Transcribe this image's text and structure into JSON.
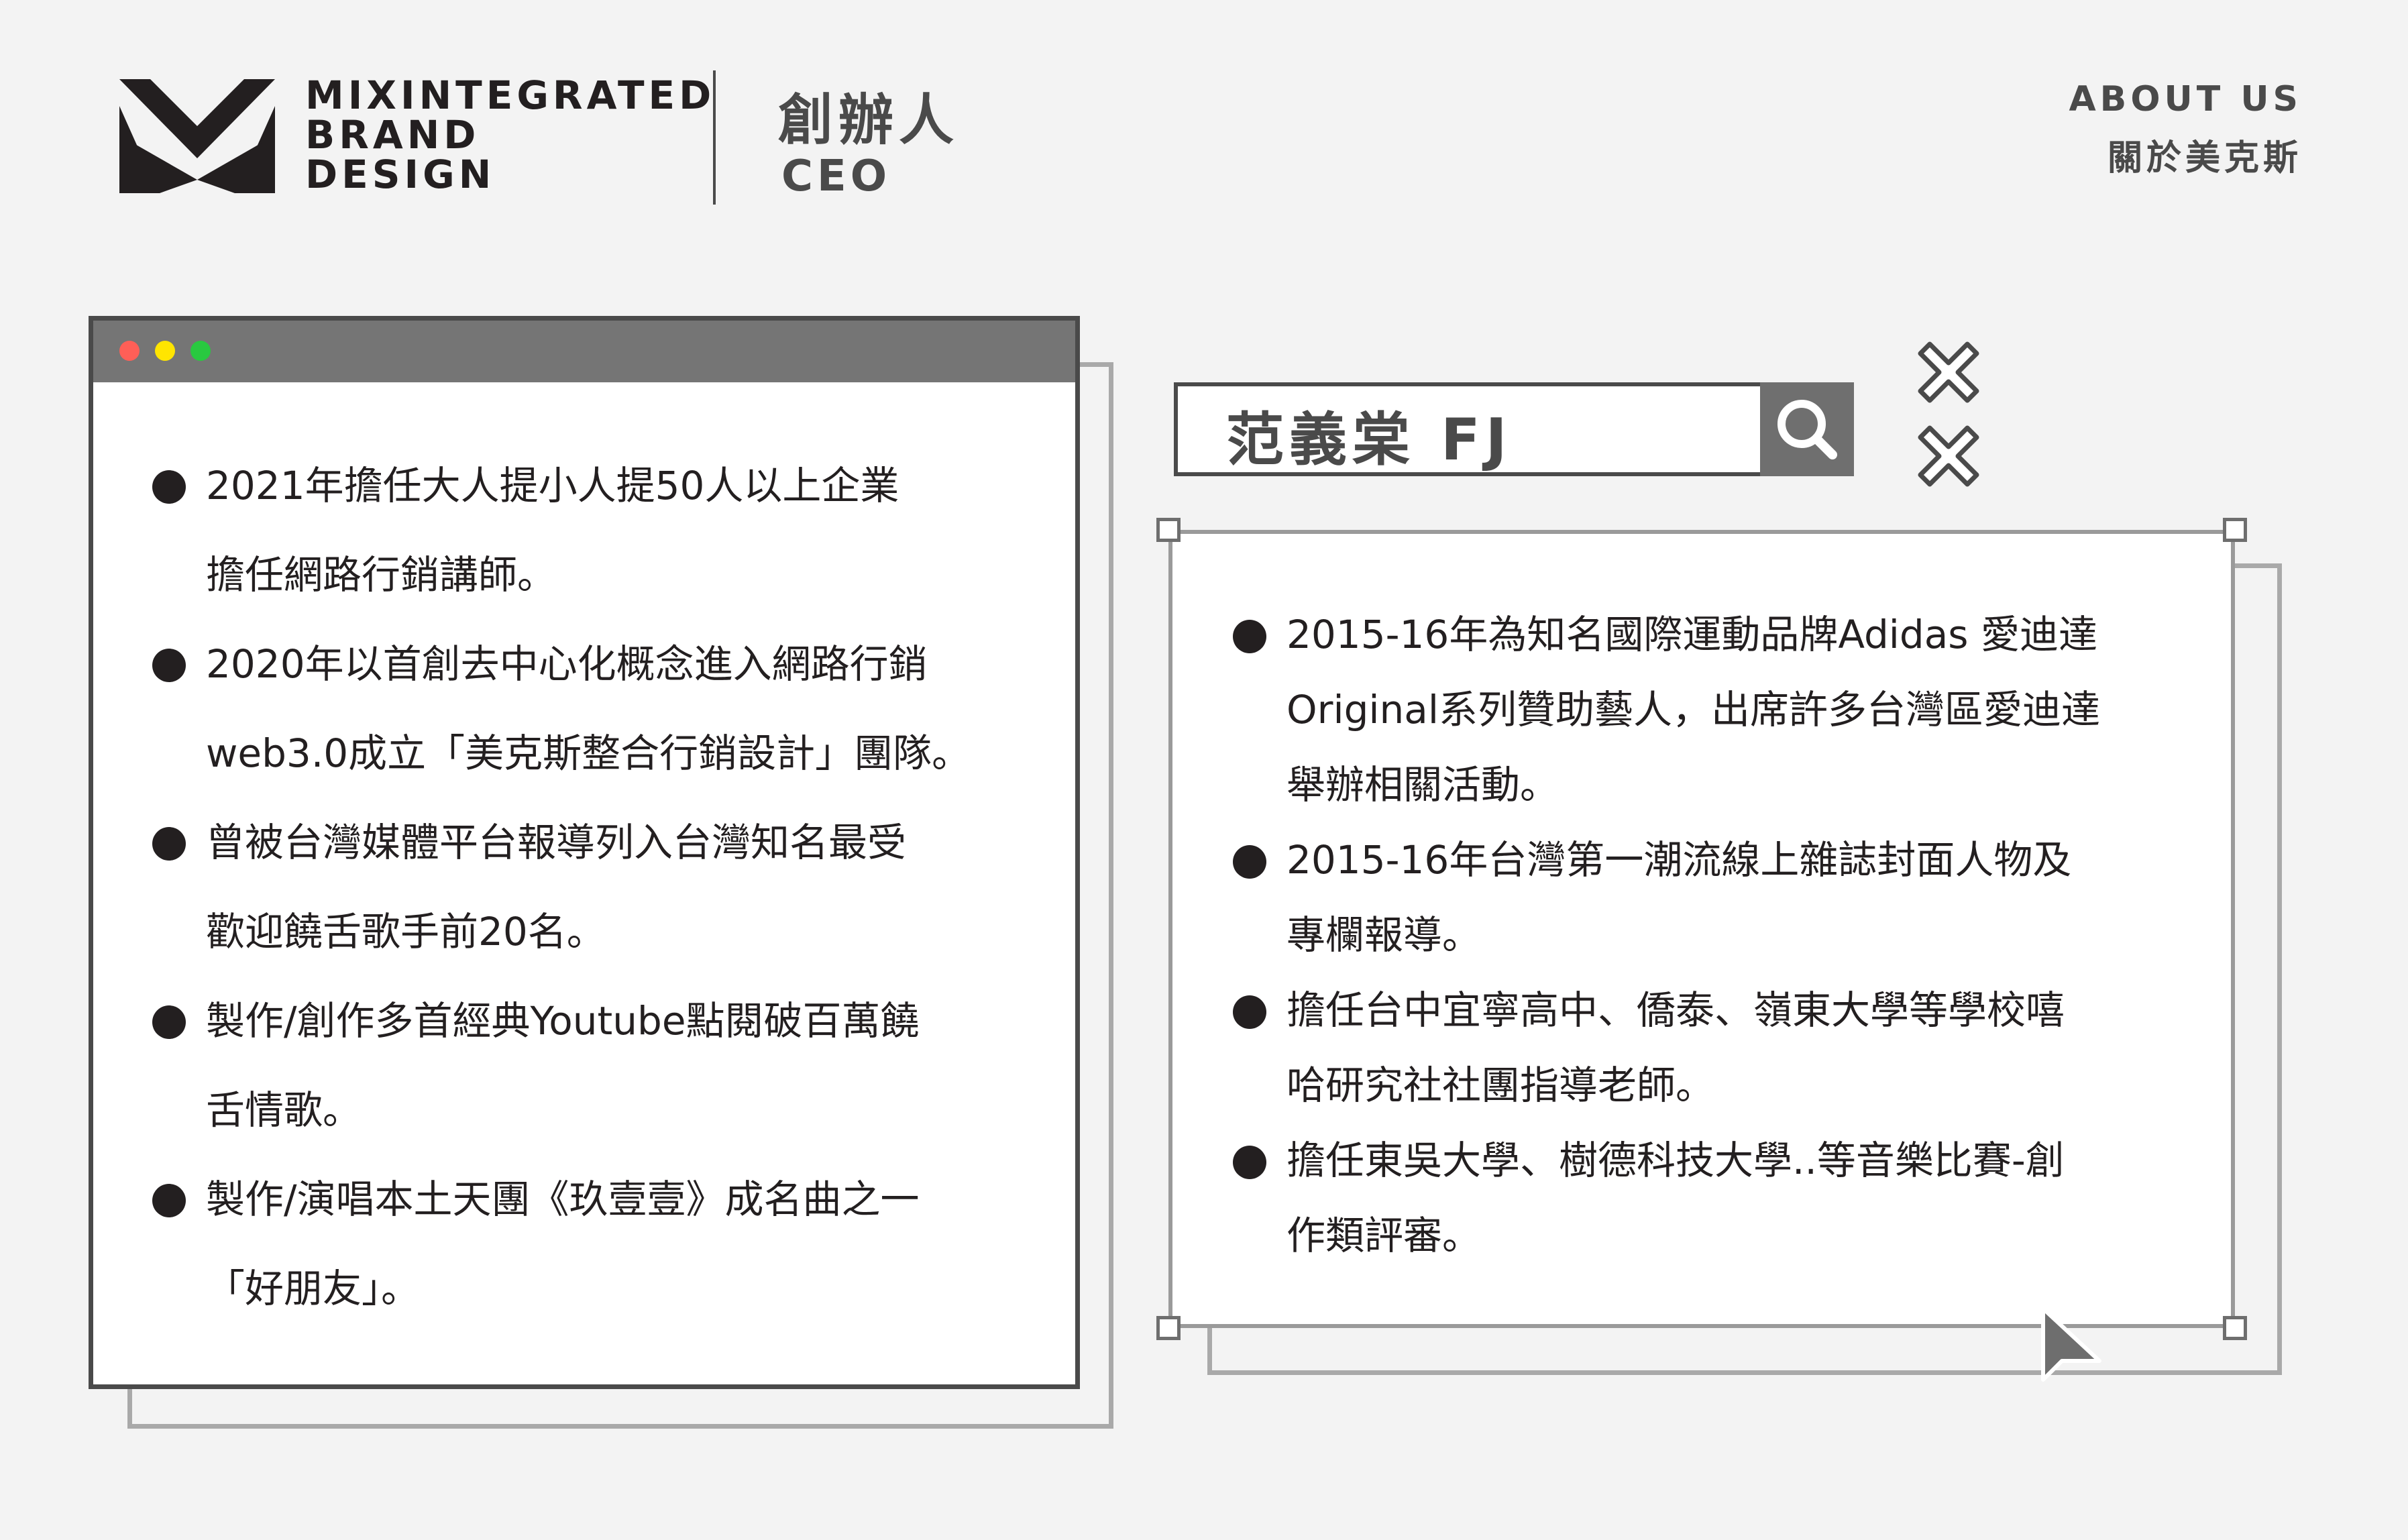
{
  "brand": {
    "logo_lines": [
      "MIXINTEGRATED",
      "BRAND",
      "DESIGN"
    ]
  },
  "header": {
    "role_zh": "創辦人",
    "role_en": "CEO",
    "nav_about_en": "ABOUT US",
    "nav_about_zh": "關於美克斯"
  },
  "window": {
    "items": [
      {
        "lines": [
          "2021年擔任大人提小人提50人以上企業",
          "擔任網路行銷講師。"
        ]
      },
      {
        "lines": [
          "2020年以首創去中心化概念進入網路行銷",
          "web3.0成立「美克斯整合行銷設計」團隊。"
        ]
      },
      {
        "lines": [
          "曾被台灣媒體平台報導列入台灣知名最受",
          "歡迎饒舌歌手前20名。"
        ]
      },
      {
        "lines": [
          "製作/創作多首經典Youtube點閱破百萬饒",
          "舌情歌。"
        ]
      },
      {
        "lines": [
          "製作/演唱本土天團《玖壹壹》成名曲之一",
          "「好朋友」。"
        ]
      }
    ]
  },
  "search": {
    "value": "范義棠 FJ"
  },
  "panel": {
    "items": [
      {
        "lines": [
          "2015-16年為知名國際運動品牌Adidas 愛迪達",
          "Original系列贊助藝人，出席許多台灣區愛迪達",
          "舉辦相關活動。"
        ]
      },
      {
        "lines": [
          "2015-16年台灣第一潮流線上雜誌封面人物及",
          "專欄報導。"
        ]
      },
      {
        "lines": [
          "擔任台中宜寧高中、僑泰、嶺東大學等學校嘻",
          "哈研究社社團指導老師。"
        ]
      },
      {
        "lines": [
          "擔任東吳大學、樹德科技大學..等音樂比賽-創",
          "作類評審。"
        ]
      }
    ]
  },
  "colors": {
    "background": "#f3f3f3",
    "dark": "#231f20",
    "titlebar": "#757575",
    "dot_red": "#ff5f57",
    "dot_yellow": "#ffe500",
    "dot_green": "#29c940"
  },
  "icons": [
    "brand-logo-icon",
    "search-icon",
    "close-x-icon",
    "cursor-arrow-icon"
  ]
}
